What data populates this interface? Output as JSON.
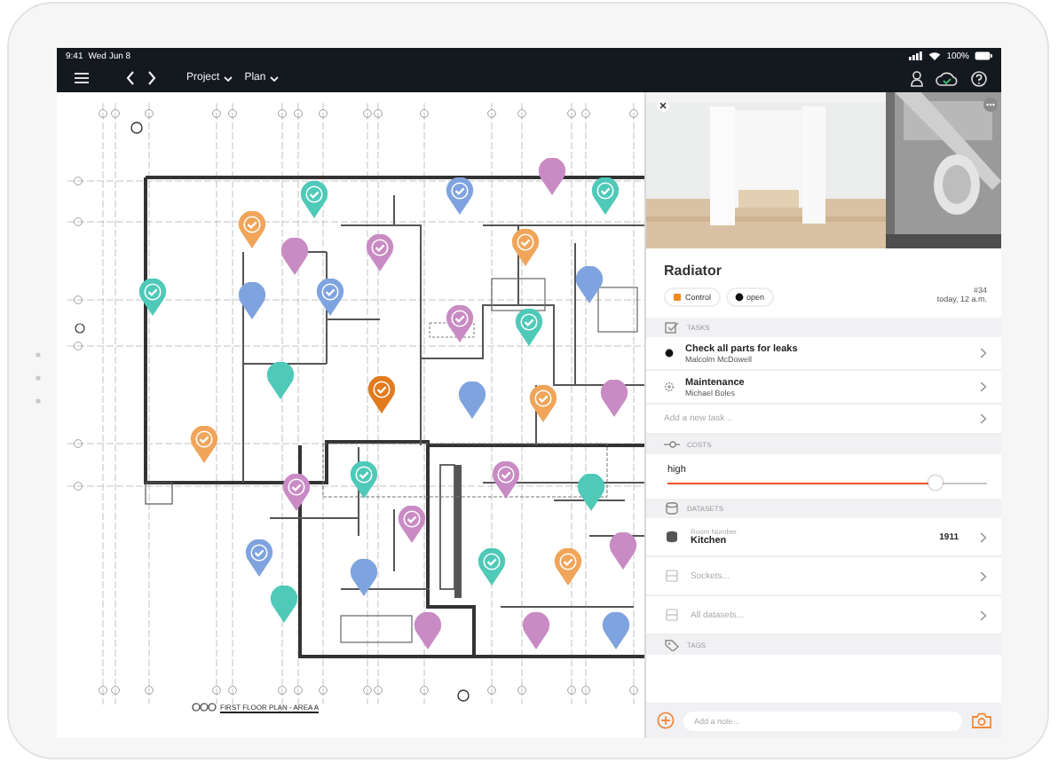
{
  "status_bar": {
    "time": "9:41",
    "date": "Wed Jun 8",
    "battery": "100%"
  },
  "nav": {
    "menus": [
      {
        "label": "Project"
      },
      {
        "label": "Plan"
      }
    ]
  },
  "plan": {
    "caption": "FIRST FLOOR PLAN - AREA A",
    "pins": [
      {
        "color": "#4fc9b8",
        "checked": true
      },
      {
        "color": "#7fa3de",
        "checked": true
      },
      {
        "color": "#c98bc4",
        "checked": false
      },
      {
        "color": "#4fc9b8",
        "checked": true
      },
      {
        "color": "#f0a55a",
        "checked": true
      },
      {
        "color": "#c98bc4",
        "checked": false
      },
      {
        "color": "#c98bc4",
        "checked": true
      },
      {
        "color": "#f0a55a",
        "checked": true
      },
      {
        "color": "#4fc9b8",
        "checked": true
      },
      {
        "color": "#7fa3de",
        "checked": false
      },
      {
        "color": "#7fa3de",
        "checked": true
      },
      {
        "color": "#7fa3de",
        "checked": false
      },
      {
        "color": "#c98bc4",
        "checked": true
      },
      {
        "color": "#4fc9b8",
        "checked": true
      },
      {
        "color": "#4fc9b8",
        "checked": false
      },
      {
        "color": "#e27a1e",
        "checked": true
      },
      {
        "color": "#7fa3de",
        "checked": false
      },
      {
        "color": "#f0a55a",
        "checked": true
      },
      {
        "color": "#c98bc4",
        "checked": false
      },
      {
        "color": "#f0a55a",
        "checked": true
      },
      {
        "color": "#c98bc4",
        "checked": true
      },
      {
        "color": "#4fc9b8",
        "checked": true
      },
      {
        "color": "#c98bc4",
        "checked": true
      },
      {
        "color": "#4fc9b8",
        "checked": false
      },
      {
        "color": "#c98bc4",
        "checked": true
      },
      {
        "color": "#c98bc4",
        "checked": false
      },
      {
        "color": "#7fa3de",
        "checked": true
      },
      {
        "color": "#4fc9b8",
        "checked": true
      },
      {
        "color": "#f0a55a",
        "checked": true
      },
      {
        "color": "#4fc9b8",
        "checked": false
      },
      {
        "color": "#7fa3de",
        "checked": false
      },
      {
        "color": "#c98bc4",
        "checked": false
      },
      {
        "color": "#c98bc4",
        "checked": false
      },
      {
        "color": "#7fa3de",
        "checked": false
      }
    ]
  },
  "detail": {
    "title": "Radiator",
    "chips": [
      {
        "label": "Control",
        "kind": "square",
        "color": "#f28a1e"
      },
      {
        "label": "open",
        "kind": "dot",
        "color": "#111111"
      }
    ],
    "number": "#34",
    "time": "today, 12 a.m.",
    "tasks": {
      "header": "TASKS",
      "items": [
        {
          "title": "Check all parts for leaks",
          "assignee": "Malcolm McDowell",
          "kind": "dot"
        },
        {
          "title": "Maintenance",
          "assignee": "Michael Boles",
          "kind": "gear"
        }
      ],
      "add_label": "Add a new task .."
    },
    "costs": {
      "header": "COSTS",
      "label": "high",
      "level": 0.84
    },
    "datasets": {
      "header": "DATASETS",
      "items": [
        {
          "kind": "value",
          "caption": "Room Number",
          "value": "Kitchen",
          "number": "1911"
        },
        {
          "kind": "link",
          "label": "Sockets..."
        },
        {
          "kind": "link",
          "label": "All datasets..."
        }
      ]
    },
    "tags": {
      "header": "TAGS"
    },
    "note": {
      "placeholder": "Add a note .."
    }
  }
}
